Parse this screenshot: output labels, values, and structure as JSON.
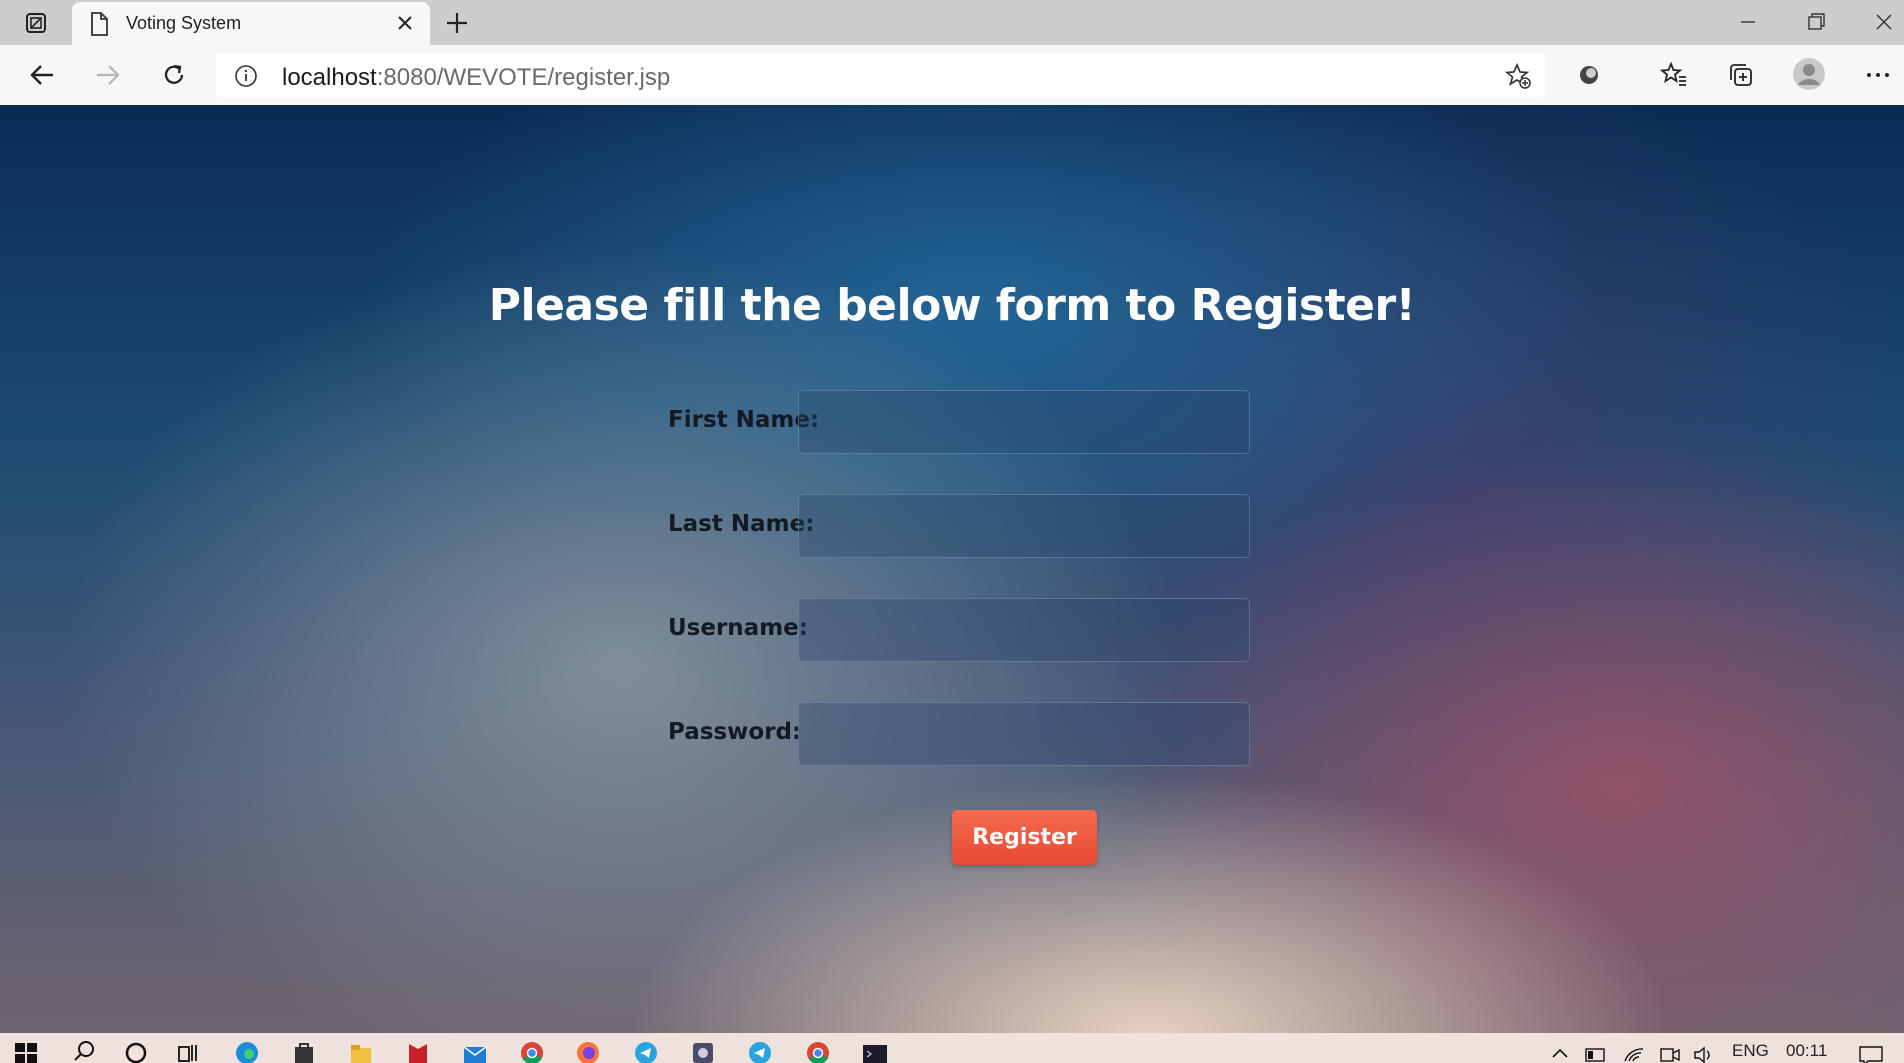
{
  "browser": {
    "tab_title": "Voting System",
    "url_host": "localhost",
    "url_rest": ":8080/WEVOTE/register.jsp"
  },
  "page": {
    "title": "Please fill the below form to Register!",
    "fields": [
      {
        "label": "First Name:",
        "value": ""
      },
      {
        "label": "Last Name:",
        "value": ""
      },
      {
        "label": "Username:",
        "value": ""
      },
      {
        "label": "Password:",
        "value": ""
      }
    ],
    "register_label": "Register"
  },
  "taskbar": {
    "language": "ENG",
    "time": "00:11"
  },
  "colors": {
    "register_button": "#e9533a",
    "title_text": "#ffffff",
    "label_text": "#131a24"
  },
  "icons": {
    "tab_actions": "tab-actions-icon",
    "page": "page-icon",
    "close": "close-icon",
    "new_tab": "plus-icon",
    "back": "back-arrow-icon",
    "forward": "forward-arrow-icon",
    "refresh": "refresh-icon",
    "info": "info-icon",
    "add_favorite": "star-plus-icon",
    "extension": "extension-icon",
    "favorites": "favorites-icon",
    "collections": "collections-icon",
    "profile": "profile-avatar-icon",
    "more": "more-icon"
  }
}
